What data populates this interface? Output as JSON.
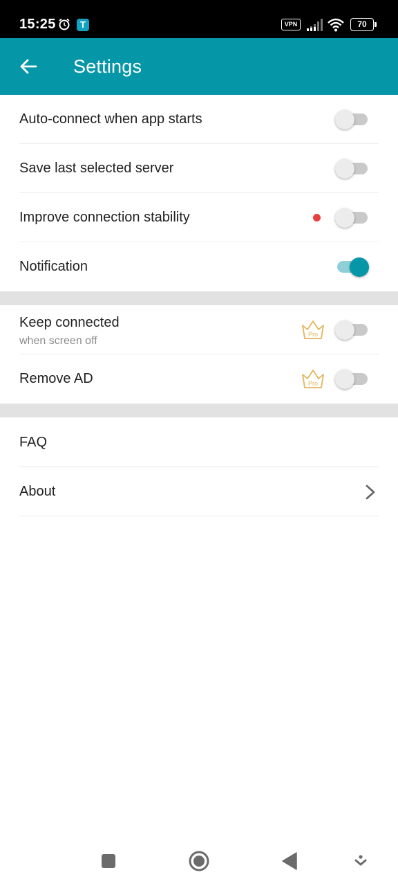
{
  "status_bar": {
    "time": "15:25",
    "app_icon_letter": "T",
    "vpn_label": "VPN",
    "battery_level": "70",
    "icons": [
      "alarm-icon",
      "app-notification-icon",
      "vpn-icon",
      "signal-icon",
      "wifi-icon",
      "battery-icon"
    ]
  },
  "app_bar": {
    "title": "Settings",
    "background": "#0596a8"
  },
  "settings": {
    "auto_connect": {
      "label": "Auto-connect when app starts",
      "enabled": false
    },
    "save_server": {
      "label": "Save last selected server",
      "enabled": false
    },
    "stability": {
      "label": "Improve connection stability",
      "enabled": false,
      "has_new_dot": true
    },
    "notification": {
      "label": "Notification",
      "enabled": true
    },
    "keep_connected": {
      "label": "Keep connected",
      "sublabel": "when screen off",
      "enabled": false,
      "pro": true,
      "pro_text": "Pro"
    },
    "remove_ad": {
      "label": "Remove AD",
      "enabled": false,
      "pro": true,
      "pro_text": "Pro"
    },
    "faq": {
      "label": "FAQ"
    },
    "about": {
      "label": "About"
    }
  },
  "colors": {
    "accent": "#0596a8",
    "accent_track": "#8fd0d8",
    "new_dot": "#e84040",
    "pro_gold": "#e2b45a",
    "section_gap": "#e2e2e2"
  },
  "nav_bar": {
    "icons": [
      "recents-square-icon",
      "home-circle-icon",
      "back-triangle-icon",
      "notification-pull-icon"
    ]
  }
}
